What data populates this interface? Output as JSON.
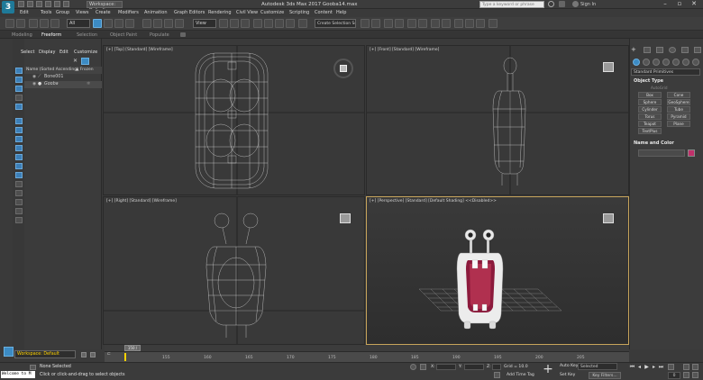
{
  "titlebar": {
    "app_title": "Autodesk 3ds Max 2017    Gooba14.max",
    "workspace": "Workspace: Default",
    "search_placeholder": "Type a keyword or phrase",
    "sign_in": "Sign In",
    "logo": "3"
  },
  "menu": [
    "Edit",
    "Tools",
    "Group",
    "Views",
    "Create",
    "Modifiers",
    "Animation",
    "Graph Editors",
    "Rendering",
    "Civil View",
    "Customize",
    "Scripting",
    "Content",
    "Help"
  ],
  "toolbar": {
    "filter_dropdown": "All",
    "refcoord_dropdown": "View",
    "create_selection_set": "Create Selection Se"
  },
  "ribbon_tabs": [
    {
      "label": "Modeling",
      "active": false
    },
    {
      "label": "Freeform",
      "active": true
    },
    {
      "label": "Selection",
      "active": false
    },
    {
      "label": "Object Paint",
      "active": false
    },
    {
      "label": "Populate",
      "active": false
    }
  ],
  "explorer": {
    "tabs": [
      "Select",
      "Display",
      "Edit",
      "Customize"
    ],
    "header": "Name (Sorted Ascending)",
    "frozen_label": "▲ Frozen",
    "rows": [
      "Bone001",
      "Gooba"
    ]
  },
  "viewports": {
    "top": "[+] [Top] [Standard] [Wireframe]",
    "front": "[+] [Front] [Standard] [Wireframe]",
    "right": "[+] [Right] [Standard] [Wireframe]",
    "perspective": "[+] [Perspective] [Standard] [Default Shading] <<Disabled>>"
  },
  "command_panel": {
    "dropdown": "Standard Primitives",
    "object_type_title": "Object Type",
    "autogrid": "AutoGrid",
    "buttons": [
      "Box",
      "Cone",
      "Sphere",
      "GeoSphere",
      "Cylinder",
      "Tube",
      "Torus",
      "Pyramid",
      "Teapot",
      "Plane",
      "TextPlus"
    ],
    "name_color_title": "Name and Color"
  },
  "timeline": {
    "workspace": "Workspace: Default",
    "slider_label": "150 / 16",
    "ticks": [
      "155",
      "160",
      "165",
      "170",
      "175",
      "180",
      "185",
      "190",
      "195",
      "200",
      "205"
    ]
  },
  "status": {
    "maxscript": "Welcome to M",
    "selection": "None Selected",
    "prompt": "Click or click-and-drag to select objects",
    "x_label": "X:",
    "y_label": "Y:",
    "z_label": "Z:",
    "grid": "Grid = 10.0",
    "add_time_tag": "Add Time Tag",
    "auto_key": "Auto Key",
    "set_key": "Set Key",
    "selected": "Selected",
    "key_filters": "Key Filters...",
    "frame": "0"
  },
  "colors": {
    "accent": "#3c8bc4",
    "active_viewport_border": "#c7a45a",
    "mouth": "#8c1a3c",
    "workspace_text": "#ffd200"
  }
}
